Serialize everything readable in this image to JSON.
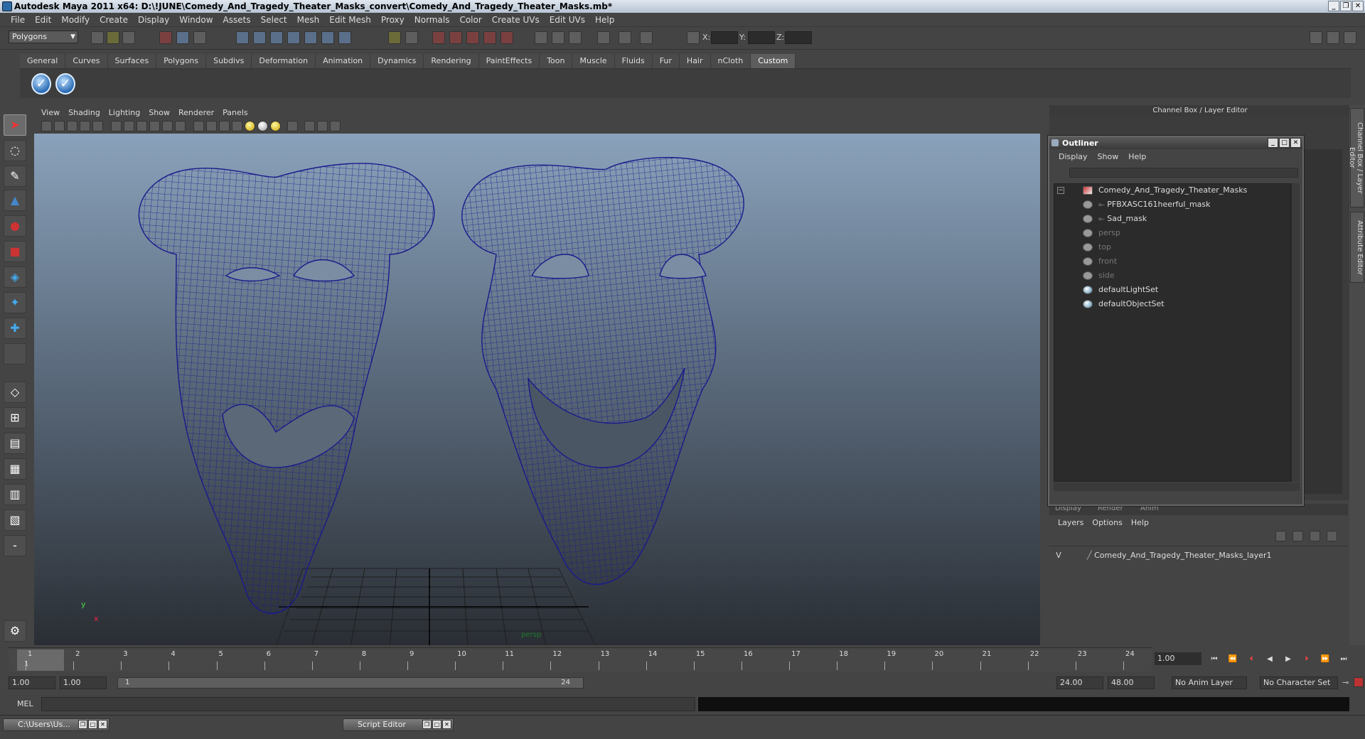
{
  "window": {
    "title": "Autodesk Maya 2011 x64: D:\\!JUNE\\Comedy_And_Tragedy_Theater_Masks_convert\\Comedy_And_Tragedy_Theater_Masks.mb*",
    "min": "_",
    "max": "❐",
    "close": "✕"
  },
  "menubar": [
    "File",
    "Edit",
    "Modify",
    "Create",
    "Display",
    "Window",
    "Assets",
    "Select",
    "Mesh",
    "Edit Mesh",
    "Proxy",
    "Normals",
    "Color",
    "Create UVs",
    "Edit UVs",
    "Help"
  ],
  "statusline": {
    "mode": "Polygons",
    "x_label": "X:",
    "y_label": "Y:",
    "z_label": "Z:"
  },
  "shelf": {
    "tabs": [
      "General",
      "Curves",
      "Surfaces",
      "Polygons",
      "Subdivs",
      "Deformation",
      "Animation",
      "Dynamics",
      "Rendering",
      "PaintEffects",
      "Toon",
      "Muscle",
      "Fluids",
      "Fur",
      "Hair",
      "nCloth",
      "Custom"
    ],
    "active_tab": "Custom",
    "buttons": [
      "✓",
      "✓"
    ]
  },
  "viewport": {
    "menu": [
      "View",
      "Shading",
      "Lighting",
      "Show",
      "Renderer",
      "Panels"
    ],
    "camera_label": "persp",
    "axis_x": "x",
    "axis_y": "y",
    "wire_color": "#1a1a8c"
  },
  "channel_box": {
    "header": "Channel Box / Layer Editor",
    "side_tabs": [
      "Channel Box / Layer Editor",
      "Attribute Editor"
    ]
  },
  "outliner": {
    "title": "Outliner",
    "menu": [
      "Display",
      "Show",
      "Help"
    ],
    "items": [
      {
        "label": "Comedy_And_Tragedy_Theater_Masks",
        "dim": false
      },
      {
        "label": "PFBXASC161heerful_mask",
        "dim": false
      },
      {
        "label": "Sad_mask",
        "dim": false
      },
      {
        "label": "persp",
        "dim": true
      },
      {
        "label": "top",
        "dim": true
      },
      {
        "label": "front",
        "dim": true
      },
      {
        "label": "side",
        "dim": true
      },
      {
        "label": "defaultLightSet",
        "dim": false
      },
      {
        "label": "defaultObjectSet",
        "dim": false
      }
    ]
  },
  "layer_editor": {
    "tabs": [
      "Display",
      "Render",
      "Anim"
    ],
    "menu": [
      "Layers",
      "Options",
      "Help"
    ],
    "layers": [
      {
        "visible": "V",
        "name": "Comedy_And_Tragedy_Theater_Masks_layer1"
      }
    ]
  },
  "timeline": {
    "ticks": [
      "1",
      "2",
      "3",
      "4",
      "5",
      "6",
      "7",
      "8",
      "9",
      "10",
      "11",
      "12",
      "13",
      "14",
      "15",
      "16",
      "17",
      "18",
      "19",
      "20",
      "21",
      "22",
      "23",
      "24"
    ],
    "current_time": "1.00",
    "current_frame_label": "1"
  },
  "range": {
    "start_time": "1.00",
    "playback_start": "1.00",
    "slider_start": "1",
    "slider_end": "24",
    "playback_end": "24.00",
    "end_time": "48.00",
    "anim_layer": "No Anim Layer",
    "character_set": "No Character Set"
  },
  "command_line": {
    "label": "MEL"
  },
  "taskbar": {
    "windows": [
      "C:\\Users\\Us...",
      "Script Editor"
    ]
  }
}
